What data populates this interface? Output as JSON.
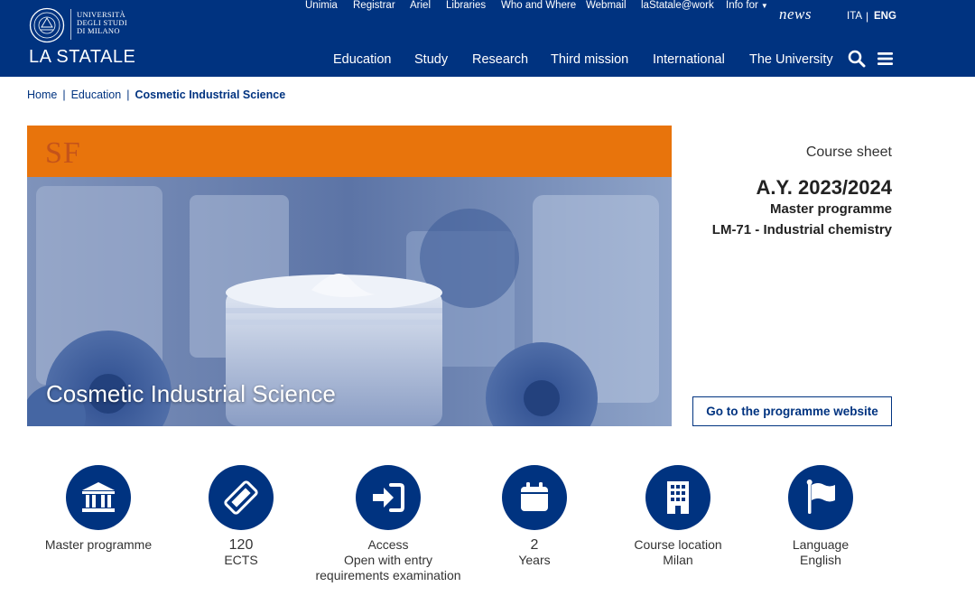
{
  "header": {
    "logo_lines": [
      "UNIVERSITÀ",
      "DEGLI STUDI",
      "DI MILANO"
    ],
    "wordmark": "LA STATALE",
    "top_links": [
      "Unimia",
      "Registrar",
      "Ariel",
      "Libraries",
      "Who and Where",
      "Webmail",
      "laStatale@work",
      "Info for"
    ],
    "news": "news",
    "languages": [
      "ITA",
      "ENG"
    ],
    "active_language": "ENG",
    "main_nav": [
      "Education",
      "Study",
      "Research",
      "Third mission",
      "International",
      "The University"
    ],
    "icons": {
      "search": "search-icon",
      "menu": "hamburger-menu-icon"
    },
    "colors": {
      "background": "#003380",
      "text": "#ffffff"
    }
  },
  "breadcrumb": [
    "Home",
    "Education",
    "Cosmetic Industrial Science"
  ],
  "hero": {
    "badge": "SF",
    "title": "Cosmetic Industrial Science",
    "colors": {
      "band": "#e8740c",
      "badge": "#c4531a",
      "photo_tint": "#3a5a98"
    }
  },
  "course_sheet": {
    "label": "Course sheet",
    "academic_year": "A.Y. 2023/2024",
    "programme_type": "Master programme",
    "class": "LM-71 - Industrial chemistry"
  },
  "programme_button": "Go to the programme website",
  "info_items": [
    {
      "icon": "institution-icon",
      "lines": [
        "Master programme"
      ]
    },
    {
      "icon": "ticket-icon",
      "lines": [
        "120",
        "ECTS"
      ]
    },
    {
      "icon": "sign-in-icon",
      "lines": [
        "Access",
        "Open with entry",
        "requirements examination"
      ]
    },
    {
      "icon": "calendar-icon",
      "lines": [
        "2",
        "Years"
      ]
    },
    {
      "icon": "building-icon",
      "lines": [
        "Course location",
        "Milan"
      ]
    },
    {
      "icon": "flag-icon",
      "lines": [
        "Language",
        "English"
      ]
    }
  ]
}
